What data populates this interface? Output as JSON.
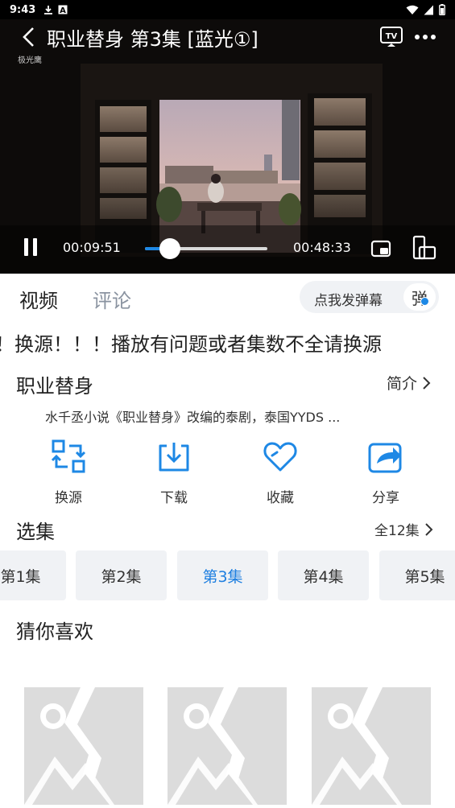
{
  "status_bar": {
    "time": "9:43",
    "icons": [
      "download-icon",
      "a-icon"
    ],
    "right_icons": [
      "wifi-icon",
      "signal-icon",
      "battery-icon"
    ]
  },
  "player": {
    "title": "职业替身 第3集 [蓝光①]",
    "watermark": "极光鹰",
    "current_time": "00:09:51",
    "total_time": "00:48:33",
    "progress": 0.203,
    "colors": {
      "accent": "#1e88e5"
    }
  },
  "tabs": {
    "video": "视频",
    "comment": "评论"
  },
  "danmu": {
    "placeholder": "点我发弹幕",
    "toggle": "弹"
  },
  "notice": "！换源！！！播放有问题或者集数不全请换源",
  "show": {
    "title": "职业替身",
    "intro_label": "简介",
    "description": "水千丞小说《职业替身》改编的泰剧，泰国YYDS ..."
  },
  "actions": [
    {
      "label": "换源",
      "icon": "switch-source-icon"
    },
    {
      "label": "下载",
      "icon": "download-icon"
    },
    {
      "label": "收藏",
      "icon": "heart-icon"
    },
    {
      "label": "分享",
      "icon": "share-icon"
    }
  ],
  "episodes": {
    "heading": "选集",
    "all_label": "全12集",
    "items": [
      "第1集",
      "第2集",
      "第3集",
      "第4集",
      "第5集"
    ],
    "active_index": 2
  },
  "recommend": {
    "heading": "猜你喜欢"
  }
}
